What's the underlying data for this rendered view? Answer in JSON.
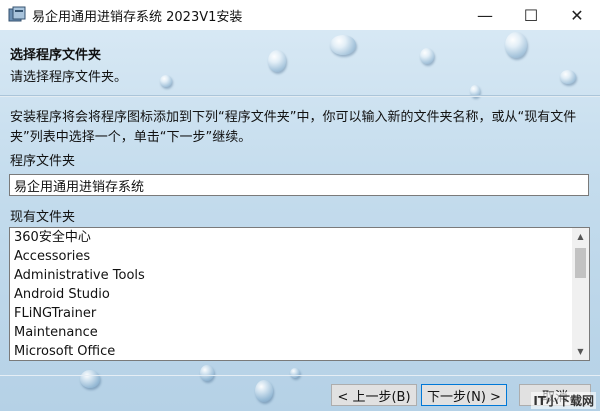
{
  "window": {
    "title": "易企用通用进销存系统 2023V1安装",
    "minimize_glyph": "—",
    "maximize_glyph": "☐",
    "close_glyph": "✕"
  },
  "header": {
    "title": "选择程序文件夹",
    "subtitle": "请选择程序文件夹。"
  },
  "body": {
    "description": "安装程序将会将程序图标添加到下列“程序文件夹”中，你可以输入新的文件夹名称，或从“现有文件夹”列表中选择一个，单击“下一步”继续。",
    "folder_label": "程序文件夹",
    "folder_value": "易企用通用进销存系统",
    "existing_label": "现有文件夹",
    "existing_folders": [
      "360安全中心",
      "Accessories",
      "Administrative Tools",
      "Android Studio",
      "FLiNGTrainer",
      "Maintenance",
      "Microsoft Office"
    ]
  },
  "footer": {
    "back_label": "< 上一步(B)",
    "next_label": "下一步(N) >",
    "cancel_label": "取消"
  },
  "watermark": "IT小下载网",
  "colors": {
    "accent": "#0078d7",
    "background": "#c4dced"
  }
}
